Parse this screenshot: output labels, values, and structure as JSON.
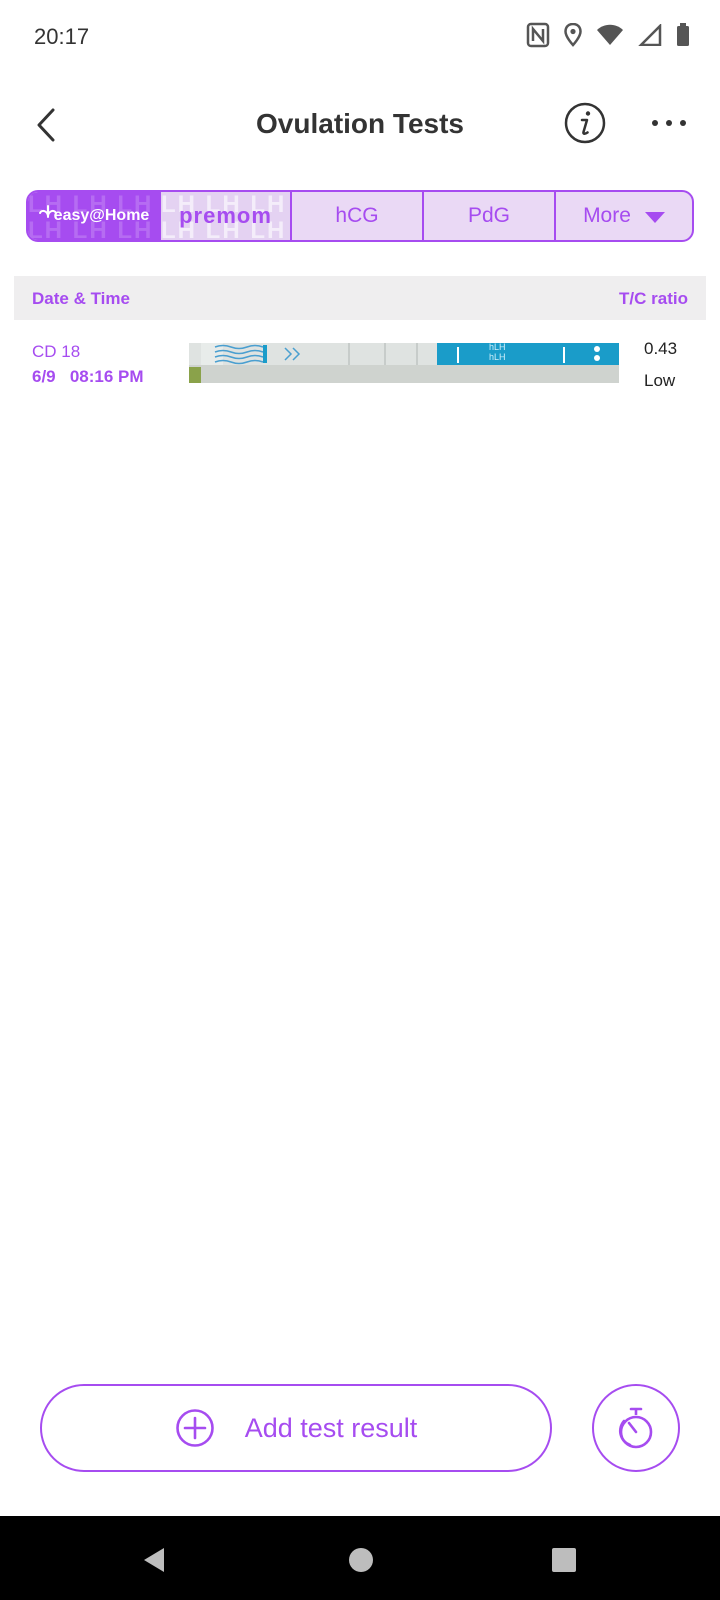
{
  "status_bar": {
    "time": "20:17",
    "icons": [
      "nfc-icon",
      "location-icon",
      "wifi-icon",
      "signal-icon",
      "battery-icon"
    ]
  },
  "header": {
    "title": "Ovulation Tests",
    "icons": [
      "back-arrow-icon",
      "info-icon",
      "more-dots-icon"
    ]
  },
  "tabs": {
    "easy_home_logo": "easy@Home",
    "premom_logo": "premom",
    "hcg": "hCG",
    "pdg": "PdG",
    "more": "More"
  },
  "table": {
    "col_date": "Date & Time",
    "col_ratio": "T/C ratio",
    "rows": [
      {
        "cycle_day": "CD 18",
        "date": "6/9",
        "time": "08:16 PM",
        "strip_labels": [
          "hLH",
          "hLH"
        ],
        "ratio": "0.43",
        "level": "Low"
      }
    ]
  },
  "actions": {
    "add_result": "Add test result"
  },
  "colors": {
    "accent": "#a64cf0",
    "tab_bg": "#ead9f5",
    "table_header_bg": "#efeeef",
    "strip_blue": "#1a9cc9",
    "nav_bar": "#000000"
  }
}
